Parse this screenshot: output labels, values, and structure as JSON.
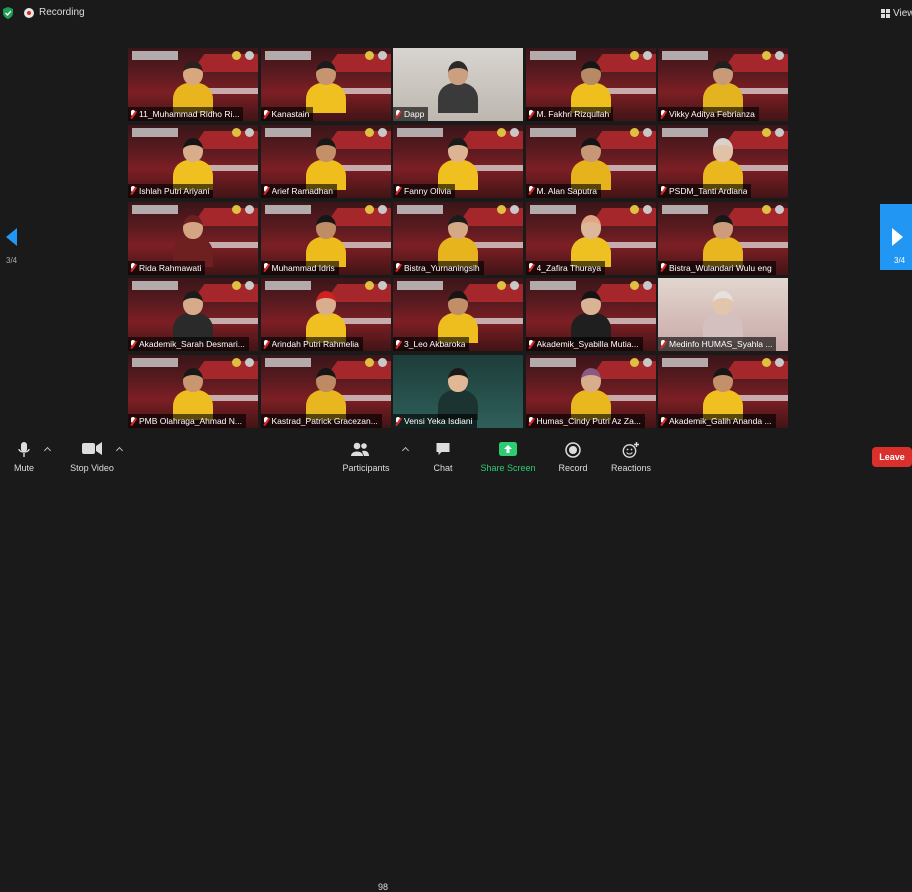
{
  "topbar": {
    "recording_label": "Recording",
    "view_label": "View"
  },
  "colors": {
    "accent": "#2196f3",
    "share": "#2ecc71",
    "leave": "#d9302c",
    "recording": "#e02828"
  },
  "gallery": {
    "page_indicator": "3/4",
    "tiles": [
      {
        "name": "11_Muhammad Ridho Ri...",
        "bg": "fgd",
        "skin": "#d9a77f",
        "shirt": "#e9b51e",
        "hair": "#2b2220"
      },
      {
        "name": "Kanastain",
        "bg": "fgd",
        "skin": "#c79470",
        "shirt": "#f0c020",
        "hair": "#1b1b1b"
      },
      {
        "name": "Dapp",
        "bg": "room",
        "skin": "#caa080",
        "shirt": "#3a3a3a",
        "hair": "#2a2a2a"
      },
      {
        "name": "M. Fakhri Rizqullah",
        "bg": "fgd",
        "skin": "#b78964",
        "shirt": "#efbf1e",
        "hair": "#161616"
      },
      {
        "name": "Vikky Aditya Febrianza",
        "bg": "fgd",
        "skin": "#c99a78",
        "shirt": "#e4b420",
        "hair": "#1f1f1f"
      },
      {
        "name": "Ishlah Putri Ariyani",
        "bg": "fgd",
        "skin": "#d8ad8c",
        "shirt": "#f0c020",
        "hair": "#151515"
      },
      {
        "name": "Arief Ramadhan",
        "bg": "fgd",
        "skin": "#c49067",
        "shirt": "#efbd1c",
        "hair": "#181818"
      },
      {
        "name": "Fanny Olivia",
        "bg": "fgd",
        "skin": "#dcb493",
        "shirt": "#f0c020",
        "hair": "#1a1a1a"
      },
      {
        "name": "M. Alan Saputra",
        "bg": "fgd",
        "skin": "#c79875",
        "shirt": "#e6b31d",
        "hair": "#141414"
      },
      {
        "name": "PSDM_Tanti Ardiana",
        "bg": "fgd",
        "skin": "#e2c2a6",
        "shirt": "#eab71f",
        "hair": "#d8d2cc"
      },
      {
        "name": "Rida Rahmawati",
        "bg": "fgd",
        "skin": "#d3a583",
        "shirt": "#6e2020",
        "hair": "#6e2020"
      },
      {
        "name": "Muhammad Idris",
        "bg": "fgd",
        "skin": "#c08c66",
        "shirt": "#eebb1c",
        "hair": "#161616"
      },
      {
        "name": "Bistra_Yurnaningsih",
        "bg": "fgd",
        "skin": "#d5a986",
        "shirt": "#e8b41e",
        "hair": "#1c1c1c"
      },
      {
        "name": "4_Zafira Thuraya",
        "bg": "fgd",
        "skin": "#dcb799",
        "shirt": "#efc021",
        "hair": "#e0a684"
      },
      {
        "name": "Bistra_Wulandari Wulu eng",
        "bg": "fgd",
        "skin": "#cd9d7b",
        "shirt": "#e9b61f",
        "hair": "#171717"
      },
      {
        "name": "Akademik_Sarah Desmari...",
        "bg": "fgd",
        "skin": "#d6ab89",
        "shirt": "#2a2a2a",
        "hair": "#1b1b1b"
      },
      {
        "name": "Arindah Putri Rahmelia",
        "bg": "fgd",
        "skin": "#d8ae8e",
        "shirt": "#f0c020",
        "hair": "#d02020"
      },
      {
        "name": "3_Leo Akbaroka",
        "bg": "fgd",
        "skin": "#c18e68",
        "shirt": "#eebe1f",
        "hair": "#151515"
      },
      {
        "name": "Akademik_Syabilla Mutia...",
        "bg": "fgd",
        "skin": "#d9b394",
        "shirt": "#1f1f1f",
        "hair": "#141414"
      },
      {
        "name": "Medinfo HUMAS_Syahla ...",
        "bg": "pink",
        "skin": "#e3c5ad",
        "shirt": "#d5c0c0",
        "hair": "#e8e0dc"
      },
      {
        "name": "PMB Olahraga_Ahmad N...",
        "bg": "fgd",
        "skin": "#c8976f",
        "shirt": "#eebe20",
        "hair": "#181818"
      },
      {
        "name": "Kastrad_Patrick Gracezan...",
        "bg": "fgd",
        "skin": "#bd8a63",
        "shirt": "#e8b61f",
        "hair": "#151515"
      },
      {
        "name": "Vensi Yeka Isdiani",
        "bg": "teal",
        "skin": "#e0b896",
        "shirt": "#1b3431",
        "hair": "#1a1a1a"
      },
      {
        "name": "Humas_Cindy Putri Az Za...",
        "bg": "fgd",
        "skin": "#d8ad8b",
        "shirt": "#e9b81f",
        "hair": "#8a5a86"
      },
      {
        "name": "Akademik_Galih Ananda ...",
        "bg": "fgd",
        "skin": "#c49069",
        "shirt": "#f0c020",
        "hair": "#161616"
      }
    ]
  },
  "toolbar": {
    "mute": "Mute",
    "stop_video": "Stop Video",
    "participants": "Participants",
    "participants_count": "98",
    "chat": "Chat",
    "share_screen": "Share Screen",
    "record": "Record",
    "reactions": "Reactions",
    "leave": "Leave"
  }
}
